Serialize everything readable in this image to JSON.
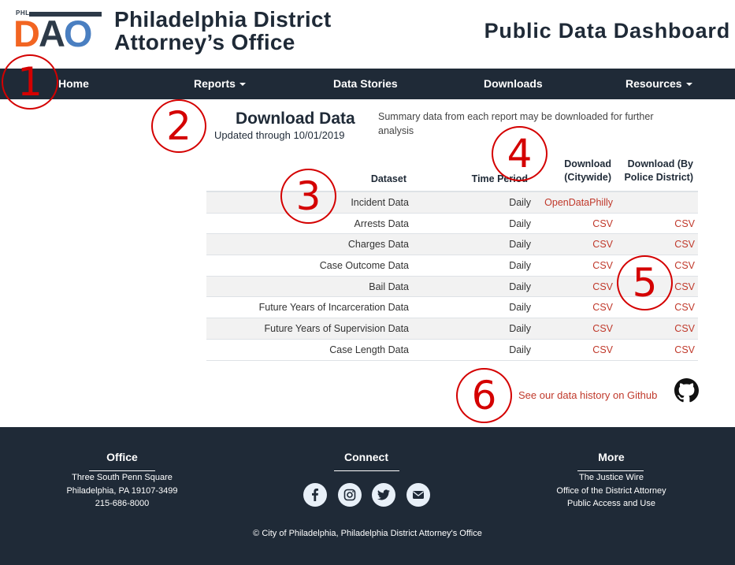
{
  "header": {
    "logo_small": "PHL",
    "logo_d": "D",
    "logo_a": "A",
    "logo_o": "O",
    "org_line1": "Philadelphia District",
    "org_line2": "Attorney’s Office",
    "dashboard_title": "Public Data Dashboard"
  },
  "nav": {
    "home": "Home",
    "reports": "Reports",
    "data_stories": "Data Stories",
    "downloads": "Downloads",
    "resources": "Resources"
  },
  "annotations": [
    "1",
    "2",
    "3",
    "4",
    "5",
    "6"
  ],
  "download": {
    "title": "Download Data",
    "updated": "Updated through 10/01/2019",
    "summary": "Summary data from each report may be downloaded for further analysis"
  },
  "table": {
    "headers": {
      "dataset": "Dataset",
      "time_period": "Time Period",
      "citywide_line1": "Download",
      "citywide_line2": "(Citywide)",
      "district_line1": "Download (By",
      "district_line2": "Police District)"
    },
    "rows": [
      {
        "name": "Incident Data",
        "period": "Daily",
        "citywide": "OpenDataPhilly",
        "district": ""
      },
      {
        "name": "Arrests Data",
        "period": "Daily",
        "citywide": "CSV",
        "district": "CSV"
      },
      {
        "name": "Charges Data",
        "period": "Daily",
        "citywide": "CSV",
        "district": "CSV"
      },
      {
        "name": "Case Outcome Data",
        "period": "Daily",
        "citywide": "CSV",
        "district": "CSV"
      },
      {
        "name": "Bail Data",
        "period": "Daily",
        "citywide": "CSV",
        "district": "CSV"
      },
      {
        "name": "Future Years of Incarceration Data",
        "period": "Daily",
        "citywide": "CSV",
        "district": "CSV"
      },
      {
        "name": "Future Years of Supervision Data",
        "period": "Daily",
        "citywide": "CSV",
        "district": "CSV"
      },
      {
        "name": "Case Length Data",
        "period": "Daily",
        "citywide": "CSV",
        "district": "CSV"
      }
    ]
  },
  "github": {
    "link_text": "See our data history on Github",
    "icon": "github-icon"
  },
  "footer": {
    "office": {
      "heading": "Office",
      "line1": "Three South Penn Square",
      "line2": "Philadelphia, PA 19107-3499",
      "line3": "215-686-8000"
    },
    "connect": {
      "heading": "Connect",
      "icons": [
        "facebook-icon",
        "instagram-icon",
        "twitter-icon",
        "email-icon"
      ]
    },
    "more": {
      "heading": "More",
      "link1": "The Justice Wire",
      "link2": "Office of the District Attorney",
      "link3": "Public Access and Use"
    },
    "copyright": "© City of Philadelphia, Philadelphia District Attorney's Office"
  },
  "colors": {
    "navy": "#1f2a37",
    "link_red": "#c0392b",
    "annotation_red": "#d40000",
    "logo_orange": "#f26522",
    "logo_blue": "#4a7fc1"
  }
}
